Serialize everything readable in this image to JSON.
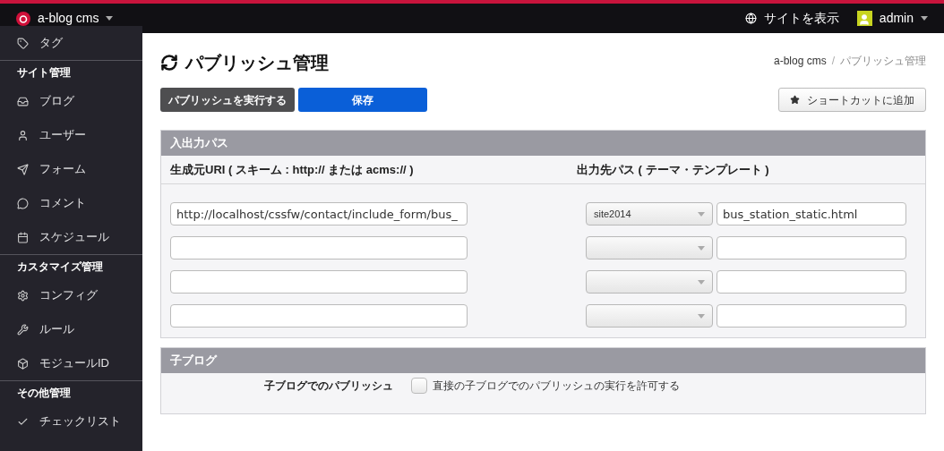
{
  "topbar": {
    "brand": "a-blog cms",
    "view_site": "サイトを表示",
    "user": "admin"
  },
  "sidebar": {
    "sections": [
      {
        "items": [
          "タグ"
        ]
      },
      {
        "heading": "サイト管理",
        "items": [
          "ブログ",
          "ユーザー",
          "フォーム",
          "コメント",
          "スケジュール"
        ]
      },
      {
        "heading": "カスタマイズ管理",
        "items": [
          "コンフィグ",
          "ルール",
          "モジュールID"
        ]
      },
      {
        "heading": "その他管理",
        "items": [
          "チェックリスト"
        ]
      }
    ]
  },
  "page": {
    "title": "パブリッシュ管理",
    "breadcrumb": [
      "a-blog cms",
      "パブリッシュ管理"
    ],
    "breadcrumb_separator": "/"
  },
  "buttons": {
    "publish": "パブリッシュを実行する",
    "save": "保存",
    "shortcut": "ショートカットに追加"
  },
  "paths_panel": {
    "title": "入出力パス",
    "source_header": "生成元URI ( スキーム : http:// または acms:// )",
    "output_header": "出力先パス ( テーマ・テンプレート )",
    "rows": [
      {
        "source": "http://localhost/cssfw/contact/include_form/bus_",
        "theme": "site2014",
        "file": "bus_station_static.html"
      },
      {},
      {},
      {}
    ]
  },
  "child_panel": {
    "title": "子ブログ",
    "label": "子ブログでのパブリッシュ",
    "checkbox_label": "直接の子ブログでのパブリッシュの実行を許可する",
    "checked": false
  }
}
